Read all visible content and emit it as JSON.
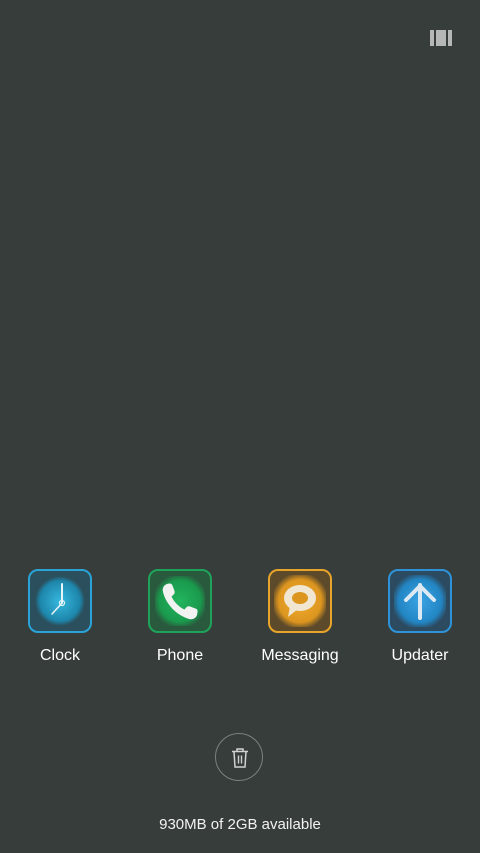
{
  "apps": [
    {
      "label": "Clock",
      "icon": "clock-icon",
      "border": "#2ba3d6",
      "fill": "#1e90b8"
    },
    {
      "label": "Phone",
      "icon": "phone-icon",
      "border": "#1fa35a",
      "fill": "#1c9a50"
    },
    {
      "label": "Messaging",
      "icon": "chat-bubble-icon",
      "border": "#e7a42b",
      "fill": "#e29a23"
    },
    {
      "label": "Updater",
      "icon": "arrow-up-icon",
      "border": "#2e93d8",
      "fill": "#2a8bc9"
    }
  ],
  "clear_all": {
    "icon": "trash-icon"
  },
  "memory": {
    "text": "930MB of 2GB available"
  }
}
